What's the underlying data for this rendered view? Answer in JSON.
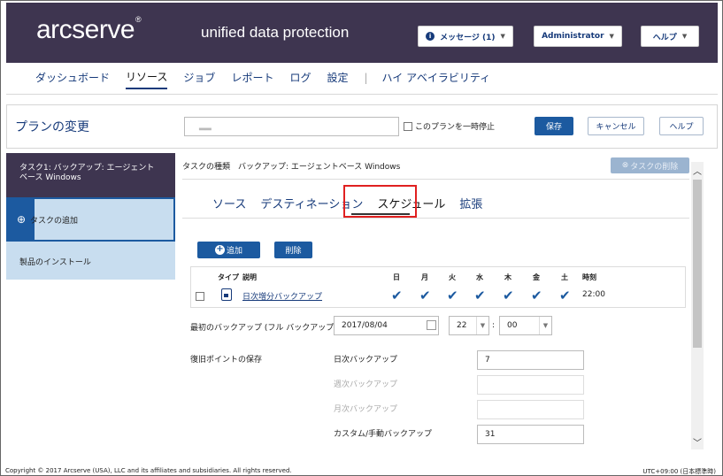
{
  "header": {
    "logo": "arcserve",
    "logo_mark": "®",
    "tagline": "unified data protection",
    "messages_label": "メッセージ (1)",
    "user_label": "Administrator",
    "help_label": "ヘルプ"
  },
  "nav": {
    "items": [
      "ダッシュボード",
      "リソース",
      "ジョブ",
      "レポート",
      "ログ",
      "設定"
    ],
    "separator": "|",
    "ha_label": "ハイ アベイラビリティ",
    "active": "リソース"
  },
  "toolbar": {
    "title": "プランの変更",
    "plan_name_value": "▂▂",
    "pause_label": "このプランを一時停止",
    "save_label": "保存",
    "cancel_label": "キャンセル",
    "help_label": "ヘルプ"
  },
  "sidebar": {
    "task_line1": "タスク1: バックアップ: エージェント",
    "task_line2": "ベース Windows",
    "add_task_label": "タスクの追加",
    "install_label": "製品のインストール"
  },
  "task": {
    "type_label": "タスクの種類　バックアップ: エージェントベース Windows",
    "delete_task_label": "タスクの削除"
  },
  "tabs": [
    "ソース",
    "デスティネーション",
    "スケジュール",
    "拡張"
  ],
  "selected_tab": "スケジュール",
  "schedule": {
    "add_label": "追加",
    "delete_label": "削除",
    "columns": {
      "type": "タイプ",
      "description": "説明",
      "sun": "日",
      "mon": "月",
      "tue": "火",
      "wed": "水",
      "thu": "木",
      "fri": "金",
      "sat": "土",
      "time": "時刻"
    },
    "rows": [
      {
        "description": "日次増分バックアップ",
        "days": [
          true,
          true,
          true,
          true,
          true,
          true,
          true
        ],
        "time": "22:00"
      }
    ]
  },
  "first_backup": {
    "label": "最初のバックアップ (フル バックアップ)",
    "date": "2017/08/04",
    "hour": "22",
    "minute": "00"
  },
  "retention": {
    "label": "復旧ポイントの保存",
    "daily_label": "日次バックアップ",
    "daily_value": "7",
    "weekly_label": "週次バックアップ",
    "monthly_label": "月次バックアップ",
    "custom_label": "カスタム/手動バックアップ",
    "custom_value": "31"
  },
  "footer": {
    "copyright": "Copyright © 2017 Arcserve (USA), LLC and its affiliates and subsidiaries. All rights reserved.",
    "timezone": "UTC+09:00 (日本標準時)"
  },
  "colors": {
    "header_bg": "#3e3550",
    "accent": "#1c5aa0",
    "highlight": "#e02020",
    "sidebar_light": "#c8ddef"
  }
}
